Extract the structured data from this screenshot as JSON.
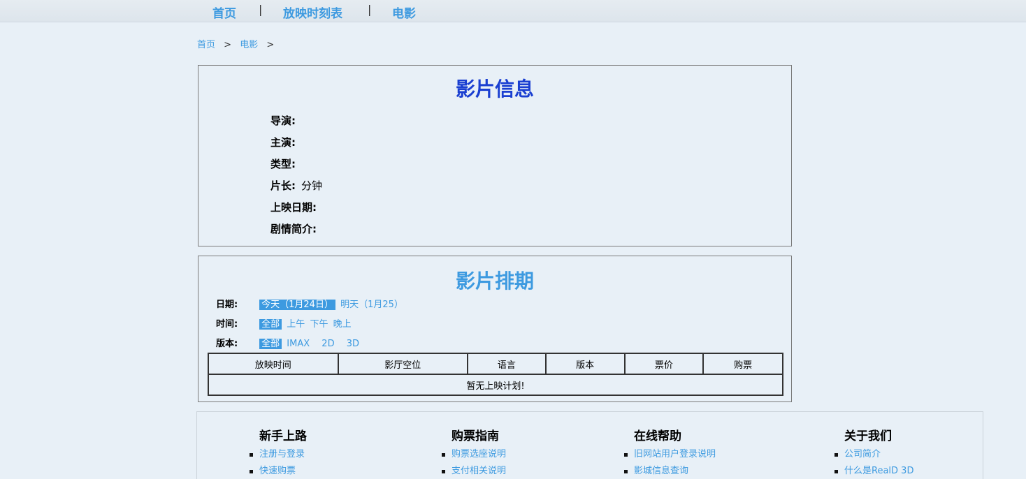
{
  "nav": {
    "home": "首页",
    "schedule": "放映时刻表",
    "movie": "电影",
    "sep": "|"
  },
  "breadcrumb": {
    "home": "首页",
    "movie": "电影",
    "gt": ">"
  },
  "info": {
    "title": "影片信息",
    "rows": [
      {
        "label": "导演:",
        "value": ""
      },
      {
        "label": "主演:",
        "value": ""
      },
      {
        "label": "类型:",
        "value": ""
      },
      {
        "label": "片长:",
        "value": "分钟"
      },
      {
        "label": "上映日期:",
        "value": ""
      },
      {
        "label": "剧情简介:",
        "value": ""
      }
    ]
  },
  "schedule": {
    "title": "影片排期",
    "date_label": "日期:",
    "date_options": [
      "今天（1月24日）",
      "明天（1月25）"
    ],
    "time_label": "时间:",
    "time_options": [
      "全部",
      "上午",
      "下午",
      "晚上"
    ],
    "version_label": "版本:",
    "version_options": [
      "全部",
      "IMAX",
      "2D",
      "3D"
    ],
    "columns": [
      "放映时间",
      "影厅空位",
      "语言",
      "版本",
      "票价",
      "购票"
    ],
    "empty": "暂无上映计划!"
  },
  "footer": [
    {
      "title": "新手上路",
      "items": [
        "注册与登录",
        "快速购票"
      ]
    },
    {
      "title": "购票指南",
      "items": [
        "购票选座说明",
        "支付相关说明"
      ]
    },
    {
      "title": "在线帮助",
      "items": [
        "旧网站用户登录说明",
        "影城信息查询"
      ]
    },
    {
      "title": "关于我们",
      "items": [
        "公司简介",
        "什么是RealD 3D"
      ]
    }
  ]
}
